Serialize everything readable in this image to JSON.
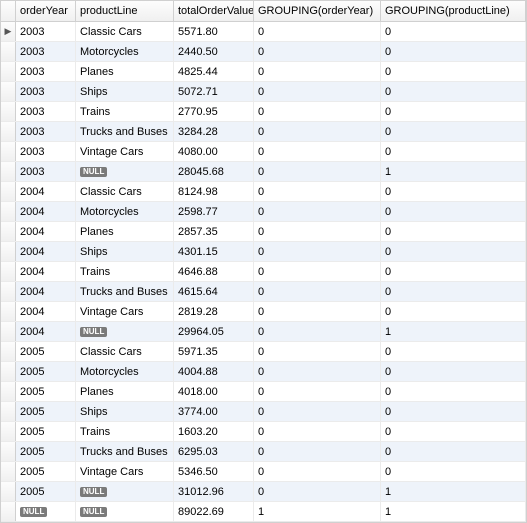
{
  "table": {
    "headers": [
      "orderYear",
      "productLine",
      "totalOrderValue",
      "GROUPING(orderYear)",
      "GROUPING(productLine)"
    ],
    "null_label": "NULL",
    "current_row_index": 0,
    "rows": [
      {
        "orderYear": "2003",
        "productLine": "Classic Cars",
        "totalOrderValue": "5571.80",
        "g1": "0",
        "g2": "0"
      },
      {
        "orderYear": "2003",
        "productLine": "Motorcycles",
        "totalOrderValue": "2440.50",
        "g1": "0",
        "g2": "0"
      },
      {
        "orderYear": "2003",
        "productLine": "Planes",
        "totalOrderValue": "4825.44",
        "g1": "0",
        "g2": "0"
      },
      {
        "orderYear": "2003",
        "productLine": "Ships",
        "totalOrderValue": "5072.71",
        "g1": "0",
        "g2": "0"
      },
      {
        "orderYear": "2003",
        "productLine": "Trains",
        "totalOrderValue": "2770.95",
        "g1": "0",
        "g2": "0"
      },
      {
        "orderYear": "2003",
        "productLine": "Trucks and Buses",
        "totalOrderValue": "3284.28",
        "g1": "0",
        "g2": "0"
      },
      {
        "orderYear": "2003",
        "productLine": "Vintage Cars",
        "totalOrderValue": "4080.00",
        "g1": "0",
        "g2": "0"
      },
      {
        "orderYear": "2003",
        "productLine": null,
        "totalOrderValue": "28045.68",
        "g1": "0",
        "g2": "1"
      },
      {
        "orderYear": "2004",
        "productLine": "Classic Cars",
        "totalOrderValue": "8124.98",
        "g1": "0",
        "g2": "0"
      },
      {
        "orderYear": "2004",
        "productLine": "Motorcycles",
        "totalOrderValue": "2598.77",
        "g1": "0",
        "g2": "0"
      },
      {
        "orderYear": "2004",
        "productLine": "Planes",
        "totalOrderValue": "2857.35",
        "g1": "0",
        "g2": "0"
      },
      {
        "orderYear": "2004",
        "productLine": "Ships",
        "totalOrderValue": "4301.15",
        "g1": "0",
        "g2": "0"
      },
      {
        "orderYear": "2004",
        "productLine": "Trains",
        "totalOrderValue": "4646.88",
        "g1": "0",
        "g2": "0"
      },
      {
        "orderYear": "2004",
        "productLine": "Trucks and Buses",
        "totalOrderValue": "4615.64",
        "g1": "0",
        "g2": "0"
      },
      {
        "orderYear": "2004",
        "productLine": "Vintage Cars",
        "totalOrderValue": "2819.28",
        "g1": "0",
        "g2": "0"
      },
      {
        "orderYear": "2004",
        "productLine": null,
        "totalOrderValue": "29964.05",
        "g1": "0",
        "g2": "1"
      },
      {
        "orderYear": "2005",
        "productLine": "Classic Cars",
        "totalOrderValue": "5971.35",
        "g1": "0",
        "g2": "0"
      },
      {
        "orderYear": "2005",
        "productLine": "Motorcycles",
        "totalOrderValue": "4004.88",
        "g1": "0",
        "g2": "0"
      },
      {
        "orderYear": "2005",
        "productLine": "Planes",
        "totalOrderValue": "4018.00",
        "g1": "0",
        "g2": "0"
      },
      {
        "orderYear": "2005",
        "productLine": "Ships",
        "totalOrderValue": "3774.00",
        "g1": "0",
        "g2": "0"
      },
      {
        "orderYear": "2005",
        "productLine": "Trains",
        "totalOrderValue": "1603.20",
        "g1": "0",
        "g2": "0"
      },
      {
        "orderYear": "2005",
        "productLine": "Trucks and Buses",
        "totalOrderValue": "6295.03",
        "g1": "0",
        "g2": "0"
      },
      {
        "orderYear": "2005",
        "productLine": "Vintage Cars",
        "totalOrderValue": "5346.50",
        "g1": "0",
        "g2": "0"
      },
      {
        "orderYear": "2005",
        "productLine": null,
        "totalOrderValue": "31012.96",
        "g1": "0",
        "g2": "1"
      },
      {
        "orderYear": null,
        "productLine": null,
        "totalOrderValue": "89022.69",
        "g1": "1",
        "g2": "1"
      }
    ]
  }
}
